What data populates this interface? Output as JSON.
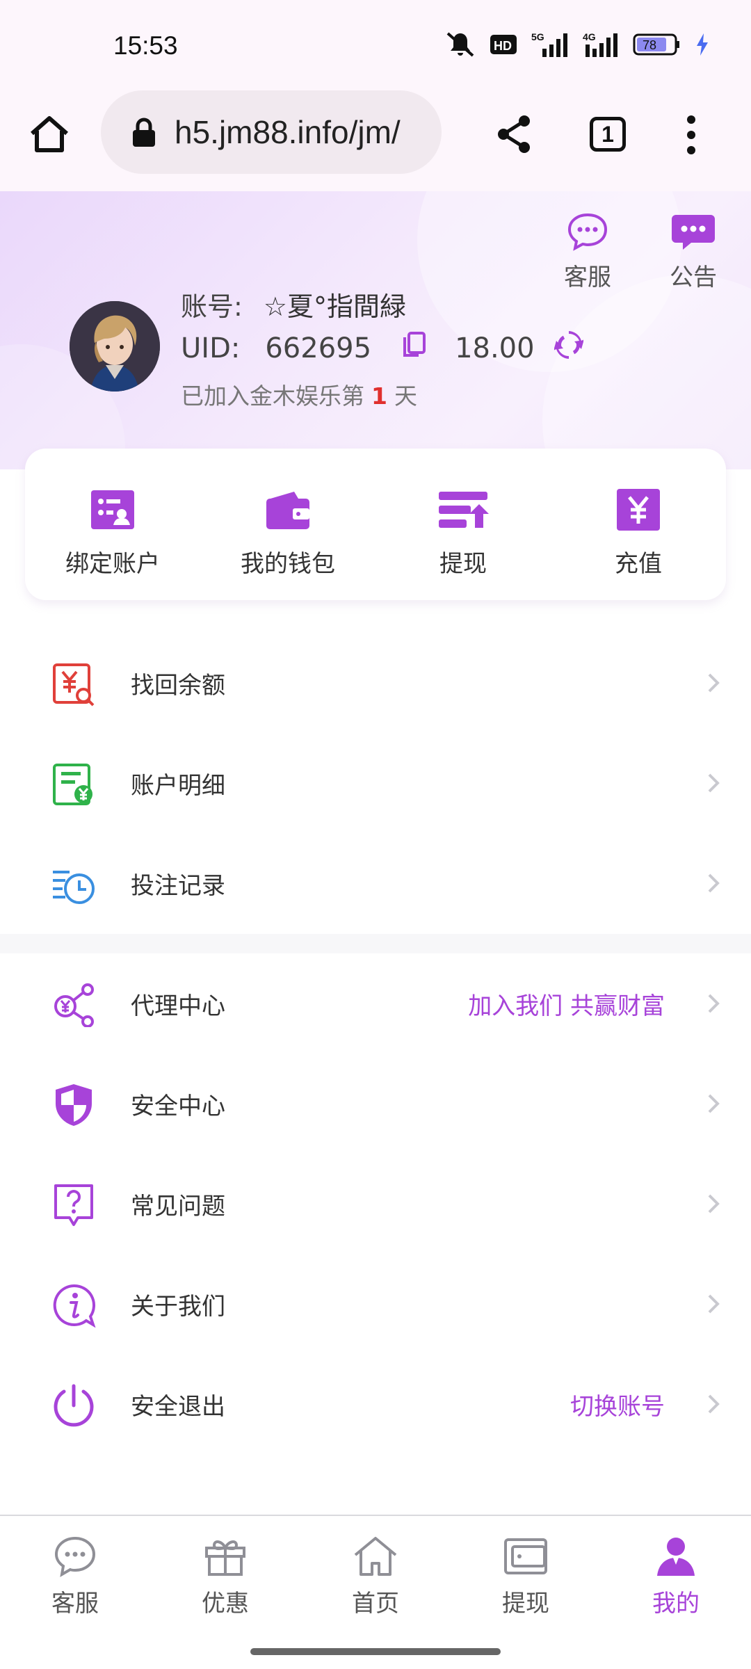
{
  "status_bar": {
    "time": "15:53",
    "battery": "78",
    "signal_1": "5G",
    "signal_2": "4G",
    "hd_badge": "HD"
  },
  "browser": {
    "url": "h5.jm88.info/jm/",
    "tab_count": "1"
  },
  "header": {
    "service_label": "客服",
    "notice_label": "公告",
    "account_label": "账号:",
    "account_name": "☆夏°指間緑",
    "uid_label": "UID:",
    "uid_value": "662695",
    "balance": "18.00",
    "joined_prefix": "已加入金木娱乐第",
    "joined_days": "1",
    "joined_suffix": "天"
  },
  "quick_actions": [
    {
      "label": "绑定账户",
      "icon": "bind-account-icon"
    },
    {
      "label": "我的钱包",
      "icon": "wallet-icon"
    },
    {
      "label": "提现",
      "icon": "withdraw-icon"
    },
    {
      "label": "充值",
      "icon": "deposit-icon"
    }
  ],
  "menu_group_1": [
    {
      "label": "找回余额",
      "icon": "recover-balance-icon"
    },
    {
      "label": "账户明细",
      "icon": "account-details-icon"
    },
    {
      "label": "投注记录",
      "icon": "bet-records-icon"
    }
  ],
  "menu_group_2": [
    {
      "label": "代理中心",
      "extra": "加入我们 共赢财富",
      "icon": "agent-icon"
    },
    {
      "label": "安全中心",
      "extra": "",
      "icon": "shield-icon"
    },
    {
      "label": "常见问题",
      "extra": "",
      "icon": "question-icon"
    },
    {
      "label": "关于我们",
      "extra": "",
      "icon": "info-icon"
    },
    {
      "label": "安全退出",
      "extra": "切换账号",
      "icon": "power-icon"
    }
  ],
  "tab_bar": [
    {
      "label": "客服",
      "icon": "chat-icon"
    },
    {
      "label": "优惠",
      "icon": "gift-icon"
    },
    {
      "label": "首页",
      "icon": "home-icon"
    },
    {
      "label": "提现",
      "icon": "wallet-icon"
    },
    {
      "label": "我的",
      "icon": "user-icon",
      "active": true
    }
  ],
  "colors": {
    "accent": "#a743d9",
    "highlight": "#e0302e"
  }
}
